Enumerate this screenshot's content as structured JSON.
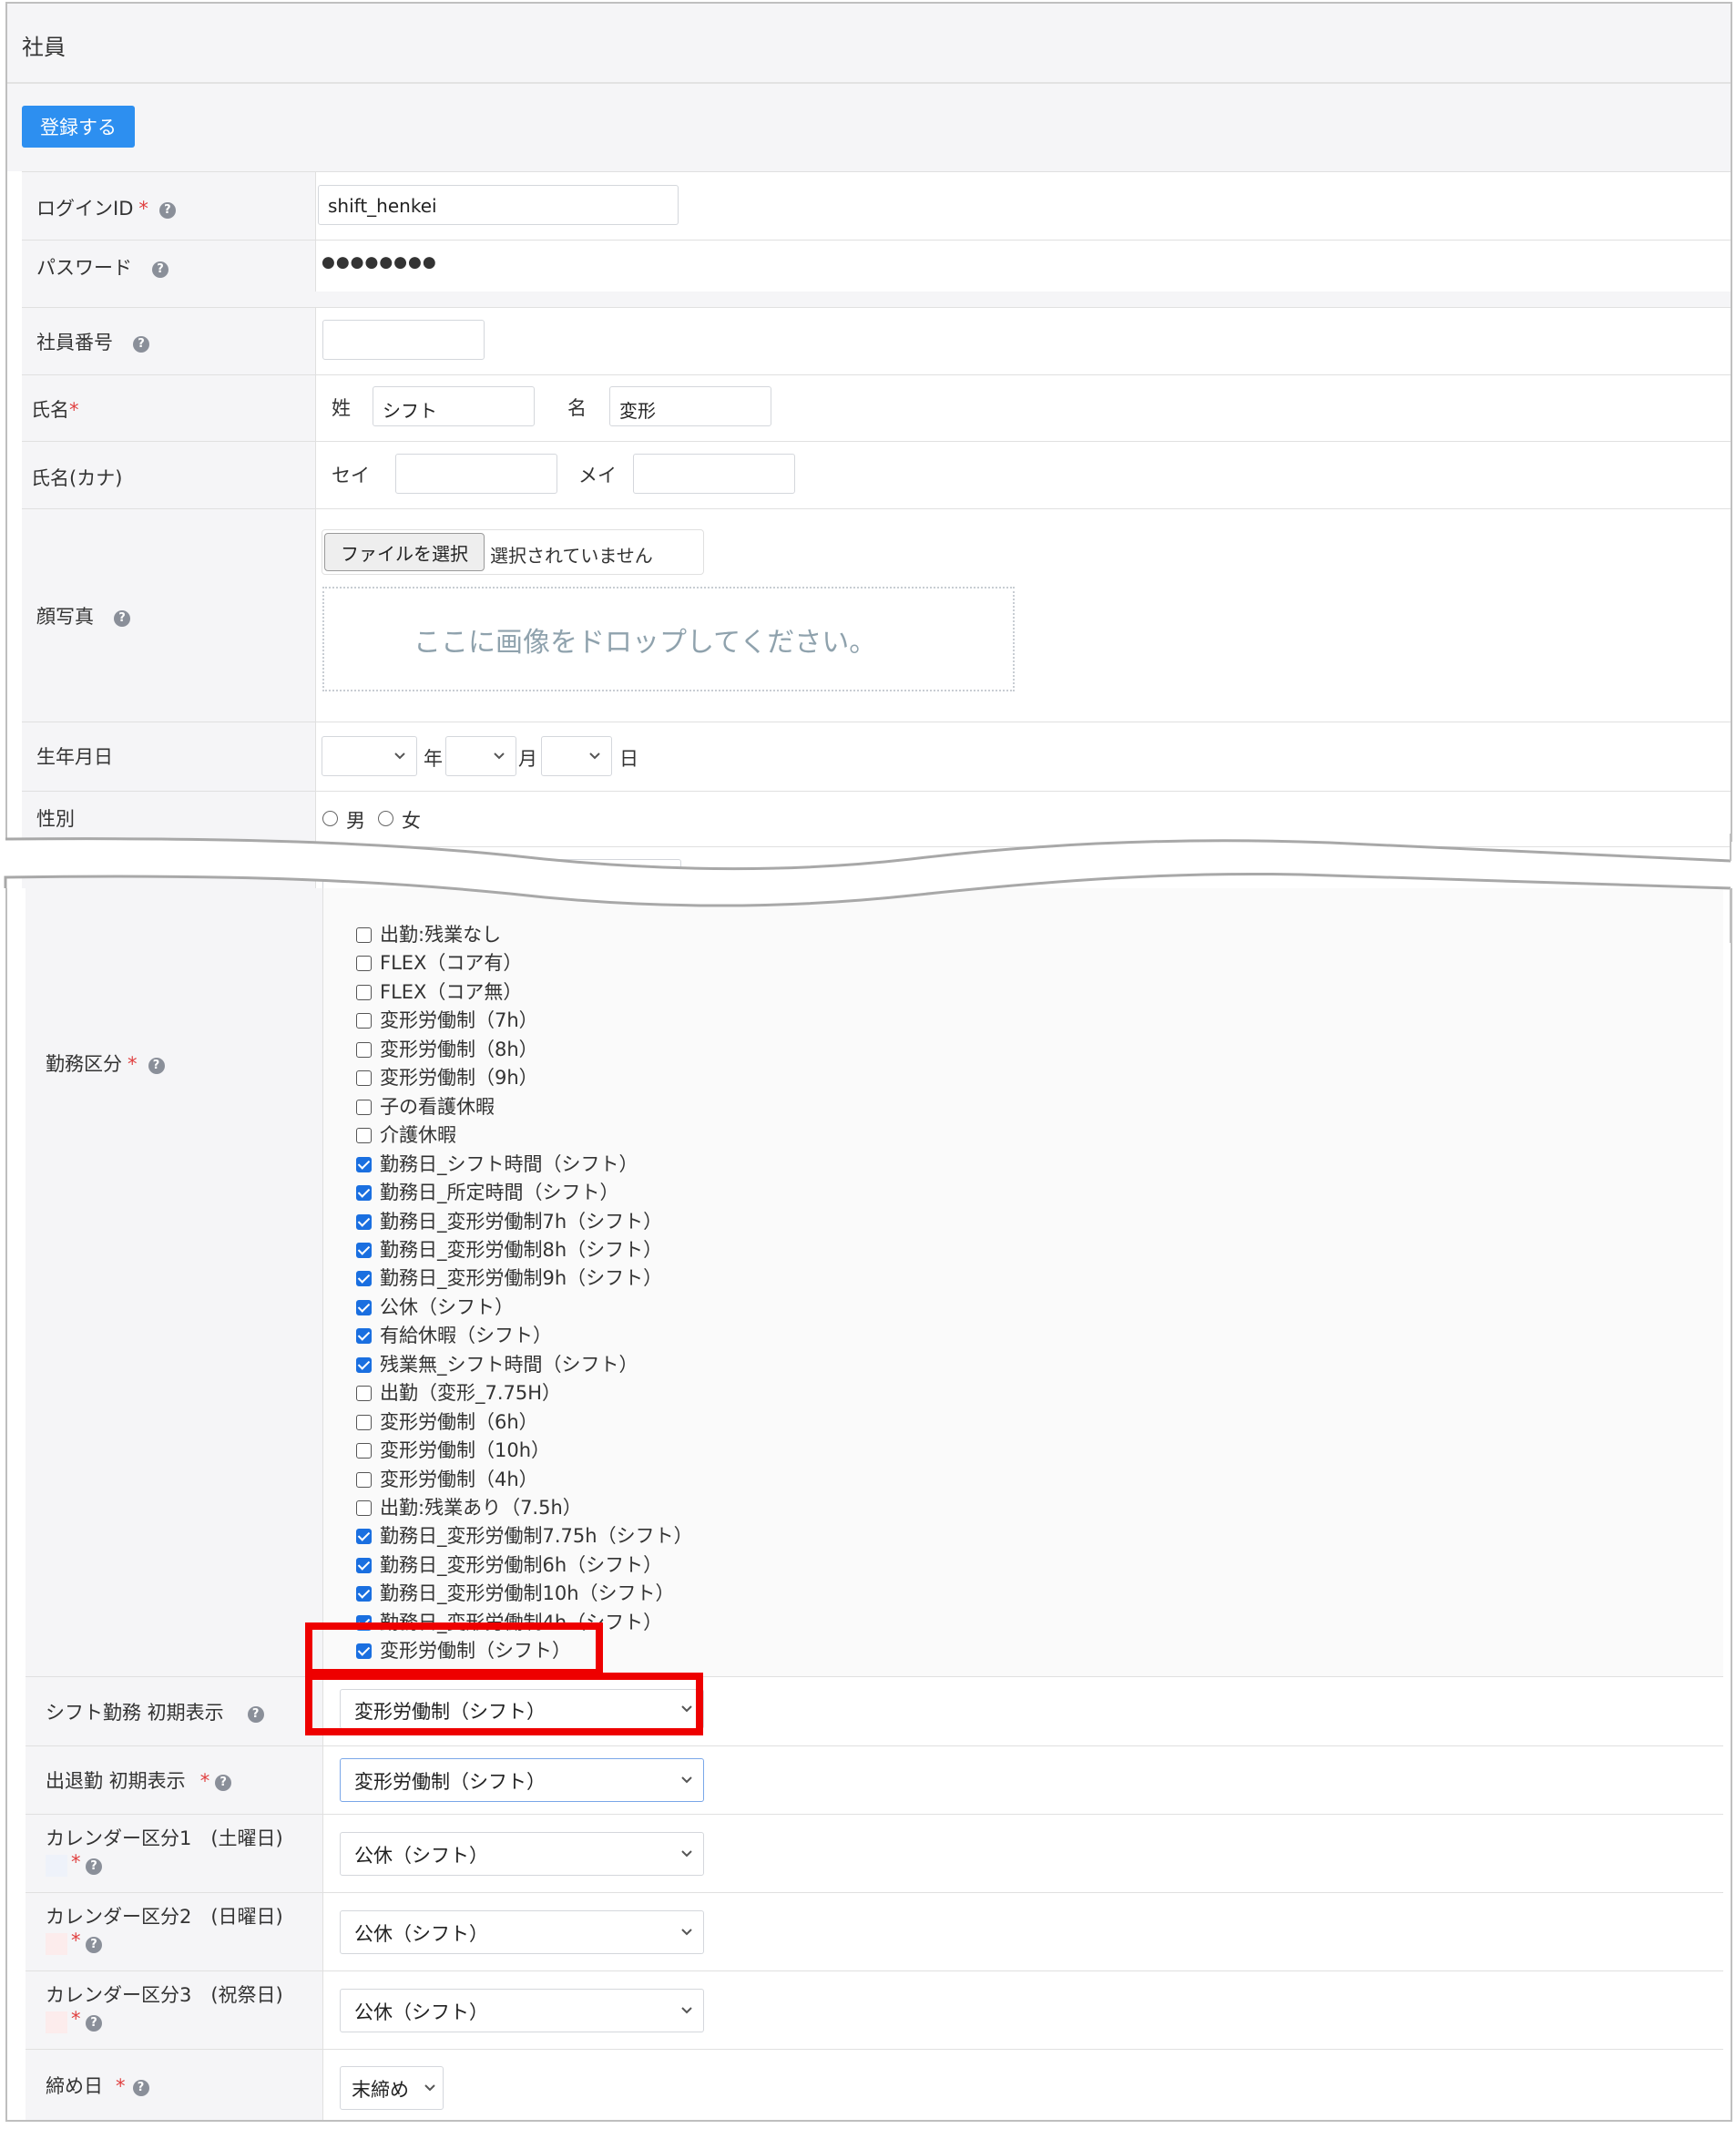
{
  "panel_title": "社員",
  "register_button": "登録する",
  "login_id": {
    "label": "ログインID",
    "required": "*",
    "value": "shift_henkei"
  },
  "password": {
    "label": "パスワード",
    "value": "●●●●●●●●"
  },
  "employee_number": {
    "label": "社員番号",
    "value": ""
  },
  "name": {
    "label": "氏名",
    "required": "*",
    "last_label": "姓",
    "last_value": "シフト",
    "first_label": "名",
    "first_value": "変形"
  },
  "name_kana": {
    "label": "氏名(カナ)",
    "sei_label": "セイ",
    "sei_value": "",
    "mei_label": "メイ",
    "mei_value": ""
  },
  "photo": {
    "label": "顔写真",
    "file_button": "ファイルを選択",
    "file_status": "選択されていません",
    "drop_text": "ここに画像をドロップしてください。"
  },
  "birthdate": {
    "label": "生年月日",
    "year_suffix": "年",
    "month_suffix": "月",
    "day_suffix": "日"
  },
  "gender": {
    "label": "性別",
    "male": "男",
    "female": "女"
  },
  "work_category": {
    "label": "勤務区分",
    "required": "*",
    "items": [
      {
        "label": "出勤:残業なし",
        "checked": false
      },
      {
        "label": "FLEX（コア有）",
        "checked": false
      },
      {
        "label": "FLEX（コア無）",
        "checked": false
      },
      {
        "label": "変形労働制（7h）",
        "checked": false
      },
      {
        "label": "変形労働制（8h）",
        "checked": false
      },
      {
        "label": "変形労働制（9h）",
        "checked": false
      },
      {
        "label": "子の看護休暇",
        "checked": false
      },
      {
        "label": "介護休暇",
        "checked": false
      },
      {
        "label": "勤務日_シフト時間（シフト）",
        "checked": true
      },
      {
        "label": "勤務日_所定時間（シフト）",
        "checked": true
      },
      {
        "label": "勤務日_変形労働制7h（シフト）",
        "checked": true
      },
      {
        "label": "勤務日_変形労働制8h（シフト）",
        "checked": true
      },
      {
        "label": "勤務日_変形労働制9h（シフト）",
        "checked": true
      },
      {
        "label": "公休（シフト）",
        "checked": true
      },
      {
        "label": "有給休暇（シフト）",
        "checked": true
      },
      {
        "label": "残業無_シフト時間（シフト）",
        "checked": true
      },
      {
        "label": "出勤（変形_7.75H）",
        "checked": false
      },
      {
        "label": "変形労働制（6h）",
        "checked": false
      },
      {
        "label": "変形労働制（10h）",
        "checked": false
      },
      {
        "label": "変形労働制（4h）",
        "checked": false
      },
      {
        "label": "出勤:残業あり（7.5h）",
        "checked": false
      },
      {
        "label": "勤務日_変形労働制7.75h（シフト）",
        "checked": true
      },
      {
        "label": "勤務日_変形労働制6h（シフト）",
        "checked": true
      },
      {
        "label": "勤務日_変形労働制10h（シフト）",
        "checked": true
      },
      {
        "label": "勤務日_変形労働制4h（シフト）",
        "checked": true
      },
      {
        "label": "変形労働制（シフト）",
        "checked": true
      }
    ]
  },
  "shift_initial": {
    "label": "シフト勤務 初期表示",
    "value": "変形労働制（シフト）"
  },
  "attendance_initial": {
    "label": "出退勤 初期表示",
    "required": "*",
    "value": "変形労働制（シフト）"
  },
  "calendar1": {
    "label": "カレンダー区分1　(土曜日)",
    "required": "*",
    "value": "公休（シフト）",
    "swatch": "#eef2fa"
  },
  "calendar2": {
    "label": "カレンダー区分2　(日曜日)",
    "required": "*",
    "value": "公休（シフト）",
    "swatch": "#fcecec"
  },
  "calendar3": {
    "label": "カレンダー区分3　(祝祭日)",
    "required": "*",
    "value": "公休（シフト）",
    "swatch": "#fcecec"
  },
  "closing_day": {
    "label": "締め日",
    "required": "*",
    "value": "末締め"
  },
  "help_icon": "question-circle-icon",
  "colors": {
    "primary": "#2d8ff0",
    "highlight": "#ee0000",
    "checkbox_on": "#1a6fe0",
    "label_bg": "#f5f5f7"
  }
}
